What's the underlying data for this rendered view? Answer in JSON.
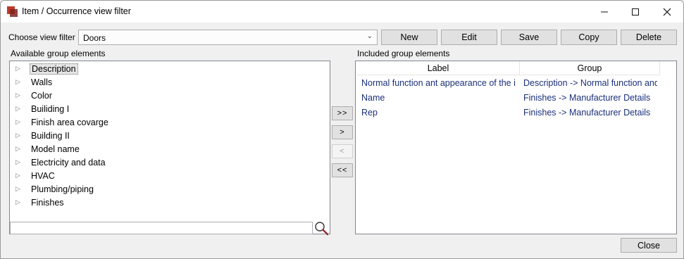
{
  "window": {
    "title": "Item / Occurrence view filter",
    "minimize_icon": "minimize-icon",
    "maximize_icon": "maximize-icon",
    "close_icon": "close-icon"
  },
  "filter": {
    "label": "Choose view filter",
    "selected": "Doors",
    "buttons": [
      "New",
      "Edit",
      "Save",
      "Copy",
      "Delete"
    ]
  },
  "available": {
    "title": "Available group elements",
    "items": [
      "Description",
      "Walls",
      "Color",
      "Builiding I",
      "Finish area covarge",
      "Building II",
      "Model name",
      "Electricity and data",
      "HVAC",
      "Plumbing/piping",
      "Finishes"
    ],
    "selected_index": 0,
    "search_value": ""
  },
  "transfer": {
    "add_all": ">>",
    "add": ">",
    "remove": "<",
    "remove_all": "<<"
  },
  "included": {
    "title": "Included group elements",
    "columns": [
      "Label",
      "Group"
    ],
    "rows": [
      [
        "Normal function ant appearance of the ite",
        "Description -> Normal function and"
      ],
      [
        "Name",
        "Finishes -> Manufacturer Details"
      ],
      [
        "Rep",
        "Finishes -> Manufacturer Details"
      ]
    ]
  },
  "footer": {
    "close_label": "Close"
  },
  "colors": {
    "accent_text": "#1a2f7a",
    "app_icon": "#c0392b"
  }
}
